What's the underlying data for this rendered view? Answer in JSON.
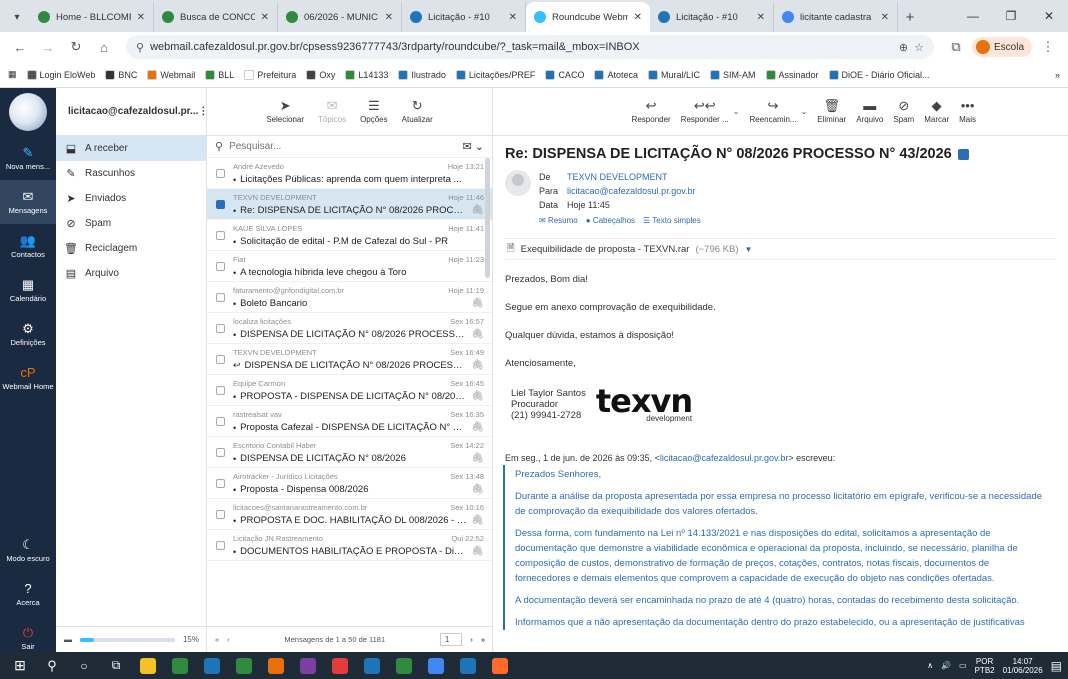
{
  "browser": {
    "tabs": [
      {
        "label": "Home - BLLCOMP",
        "color": "#2d8a3e"
      },
      {
        "label": "Busca de CONCOR",
        "color": "#2d8a3e"
      },
      {
        "label": "06/2026 - MUNIC",
        "color": "#2d8a3e"
      },
      {
        "label": "Licitação - #10",
        "color": "#1f73b7"
      },
      {
        "label": "Roundcube Webm",
        "color": "#37beff",
        "active": true
      },
      {
        "label": "Licitação - #10",
        "color": "#1f73b7"
      },
      {
        "label": "licitante cadastra",
        "color": "#4285f4"
      }
    ],
    "url": "webmail.cafezaldosul.pr.gov.br/cpsess9236777743/3rdparty/roundcube/?_task=mail&_mbox=INBOX",
    "profile": "Escola",
    "bookmarks": [
      {
        "label": "Login EloWeb",
        "color": "#555"
      },
      {
        "label": "BNC",
        "color": "#333"
      },
      {
        "label": "Webmail",
        "color": "#e8710a"
      },
      {
        "label": "BLL",
        "color": "#2d8a3e"
      },
      {
        "label": "Prefeitura",
        "color": "#fff"
      },
      {
        "label": "Oxy",
        "color": "#444"
      },
      {
        "label": "L14133",
        "color": "#2d8a3e"
      },
      {
        "label": "Ilustrado",
        "color": "#1f73b7"
      },
      {
        "label": "Licitações/PREF",
        "color": "#1f73b7"
      },
      {
        "label": "CACO",
        "color": "#1f73b7"
      },
      {
        "label": "Atoteca",
        "color": "#1f73b7"
      },
      {
        "label": "Mural/LIC",
        "color": "#1f73b7"
      },
      {
        "label": "SIM-AM",
        "color": "#1f73b7"
      },
      {
        "label": "Assinador",
        "color": "#2d8a3e"
      },
      {
        "label": "DiOE - Diário Oficial...",
        "color": "#1f73b7"
      }
    ]
  },
  "nav": [
    {
      "label": "Nova mens...",
      "icon": "edit-icon",
      "glyph": "✎",
      "color": "#37beff"
    },
    {
      "label": "Mensagens",
      "icon": "envelope-icon",
      "glyph": "✉",
      "sel": true
    },
    {
      "label": "Contactos",
      "icon": "contacts-icon",
      "glyph": "👥"
    },
    {
      "label": "Calendário",
      "icon": "calendar-icon",
      "glyph": "▦"
    },
    {
      "label": "Definições",
      "icon": "gear-icon",
      "glyph": "⚙"
    },
    {
      "label": "Webmail Home",
      "icon": "cpanel-icon",
      "glyph": "cP",
      "color": "#e8710a"
    }
  ],
  "nav_bottom": [
    {
      "label": "Modo escuro",
      "icon": "moon-icon",
      "glyph": "☾"
    },
    {
      "label": "Acerca",
      "icon": "help-icon",
      "glyph": "?"
    },
    {
      "label": "Sair",
      "icon": "power-icon",
      "glyph": "⏻",
      "color": "#e23c3c"
    }
  ],
  "account": "licitacao@cafezaldosul.pr...",
  "folders": [
    {
      "label": "A receber",
      "glyph": "⬓",
      "sel": true
    },
    {
      "label": "Rascunhos",
      "glyph": "✎"
    },
    {
      "label": "Enviados",
      "glyph": "➤"
    },
    {
      "label": "Spam",
      "glyph": "⊘"
    },
    {
      "label": "Reciclagem",
      "glyph": "🗑"
    },
    {
      "label": "Arquivo",
      "glyph": "▤"
    }
  ],
  "quota": "15%",
  "list_toolbar": [
    {
      "label": "Selecionar",
      "glyph": "➤"
    },
    {
      "label": "Tópicos",
      "glyph": "✉",
      "disabled": true
    },
    {
      "label": "Opções",
      "glyph": "☰"
    },
    {
      "label": "Atualizar",
      "glyph": "↻"
    }
  ],
  "search_placeholder": "Pesquisar...",
  "messages": [
    {
      "from": "André Azevedo",
      "date": "Hoje 13:21",
      "subject": "Licitações Públicas: aprenda com quem interpreta ...",
      "clip": false
    },
    {
      "from": "TEXVN DEVELOPMENT",
      "date": "Hoje 11:46",
      "subject": "Re: DISPENSA DE LICITAÇÃO N° 08/2026 PROCES...",
      "clip": true,
      "sel": true
    },
    {
      "from": "KAUE SILVA LOPES",
      "date": "Hoje 11:41",
      "subject": "Solicitação de edital - P.M de Cafezal do Sul - PR",
      "clip": false
    },
    {
      "from": "Fiat",
      "date": "Hoje 11:23",
      "subject": "A tecnologia híbrida leve chegou à Toro",
      "clip": false
    },
    {
      "from": "faturamento@grifondigital.com.br",
      "date": "Hoje 11:19",
      "subject": "Boleto Bancario",
      "clip": true
    },
    {
      "from": "localiza licitações",
      "date": "Sex 16:57",
      "subject": "DISPENSA DE LICITAÇÃO N° 08/2026 PROCESSO ...",
      "clip": true
    },
    {
      "from": "TEXVN DEVELOPMENT",
      "date": "Sex 16:49",
      "subject": "DISPENSA DE LICITAÇÃO N° 08/2026 PROCESSO ...",
      "clip": true,
      "replied": true
    },
    {
      "from": "Equipe Carmon",
      "date": "Sex 16:45",
      "subject": "PROPOSTA - DISPENSA DE LICITAÇÃO N° 08/202...",
      "clip": true
    },
    {
      "from": "rastrealsat vav",
      "date": "Sex 16:35",
      "subject": "Proposta Cafezal - DISPENSA DE LICITAÇÃO N° 08...",
      "clip": true
    },
    {
      "from": "Escritorio Contabil Haber",
      "date": "Sex 14:22",
      "subject": "DISPENSA DE LICITAÇÃO N° 08/2026",
      "clip": true
    },
    {
      "from": "Airotracker - Jurídico Licitações",
      "date": "Sex 13:48",
      "subject": "Proposta - Dispensa 008/2026",
      "clip": true
    },
    {
      "from": "licitacoes@santanarastreamento.com.br",
      "date": "Sex 10:16",
      "subject": "PROPOSTA E DOC. HABILITAÇÃO DL 008/2026 - R...",
      "clip": true
    },
    {
      "from": "Licitação JN Rastreamento",
      "date": "Qui 22:52",
      "subject": "DOCUMENTOS HABILITAÇÃO E PROPOSTA - Disp...",
      "clip": true
    }
  ],
  "pager": {
    "text": "Mensagens de 1 a 50 de 1181",
    "page": "1"
  },
  "reader_toolbar": [
    {
      "label": "Responder",
      "glyph": "↩"
    },
    {
      "label": "Responder ...",
      "glyph": "↩↩",
      "dd": true
    },
    {
      "label": "Reencamin...",
      "glyph": "↪",
      "dd": true
    },
    {
      "label": "Eliminar",
      "glyph": "🗑"
    },
    {
      "label": "Arquivo",
      "glyph": "▬"
    },
    {
      "label": "Spam",
      "glyph": "⊘"
    },
    {
      "label": "Marcar",
      "glyph": "◆"
    },
    {
      "label": "Mais",
      "glyph": "•••"
    }
  ],
  "mail": {
    "subject": "Re: DISPENSA DE LICITAÇÃO N° 08/2026 PROCESSO N° 43/2026",
    "from_label": "De",
    "from": "TEXVN DEVELOPMENT",
    "to_label": "Para",
    "to": "licitacao@cafezaldosul.pr.gov.br",
    "date_label": "Data",
    "date": "Hoje 11:45",
    "links": [
      "Resumo",
      "Cabeçalhos",
      "Texto simples"
    ],
    "attachment": "Exequibilidade de proposta - TEXVN.rar",
    "attachment_size": "(~796 KB)",
    "body": [
      "Prezados, Bom dia!",
      "Segue em anexo comprovação de exequibilidade.",
      "Qualquer dúvida, estamos à disposição!",
      "Atenciosamente,"
    ],
    "signature": [
      "Liel Taylor Santos",
      "Procurador",
      "(21) 99941-2728"
    ],
    "logo_main": "texvn",
    "logo_sub": "development",
    "quote_pre": "Em seg., 1 de jun. de 2026 às 09:35, <",
    "quote_email": "licitacao@cafezaldosul.pr.gov.br",
    "quote_post": "> escreveu:",
    "quote": [
      "Prezados Senhores,",
      "Durante a análise da proposta apresentada por essa empresa no processo licitatório em epígrafe, verificou-se a necessidade de comprovação da exequibilidade dos valores ofertados.",
      "Dessa forma, com fundamento na Lei nº 14.133/2021 e nas disposições do edital, solicitamos a apresentação de documentação que demonstre a viabilidade econômica e operacional da proposta, incluindo, se necessário, planilha de composição de custos, demonstrativo de formação de preços, cotações, contratos, notas fiscais, documentos de fornecedores e demais elementos que comprovem a capacidade de execução do objeto nas condições ofertadas.",
      "A documentação deverá ser encaminhada no prazo de até 4 (quatro) horas, contadas do recebimento desta solicitação.",
      "Informamos que a não apresentação da documentação dentro do prazo estabelecido, ou a apresentação de justificativas"
    ]
  },
  "taskbar": {
    "apps": [
      "#f6c026",
      "#2d8a3e",
      "#1f73b7",
      "#2d8a3e",
      "#e8710a",
      "#7b3fa0",
      "#e23c3c",
      "#1f73b7",
      "#2d8a3e",
      "#4285f4",
      "#1f73b7",
      "#ff6b2a"
    ],
    "lang": "POR",
    "layout": "PTB2",
    "time": "14:07",
    "date": "01/06/2026"
  }
}
